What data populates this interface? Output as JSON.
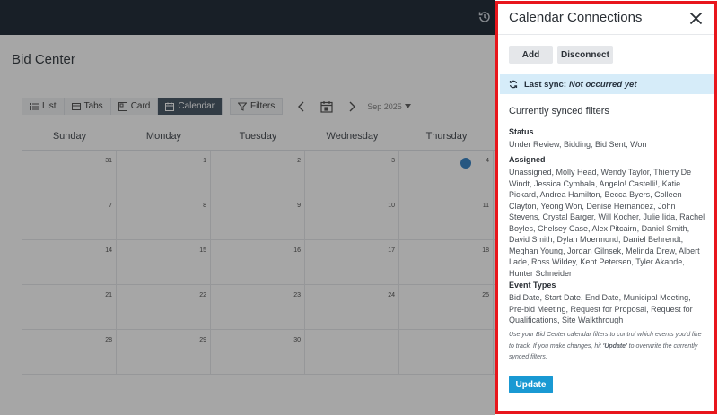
{
  "app": {
    "page_title": "Bid Center",
    "view_buttons": [
      "List",
      "Tabs",
      "Card",
      "Calendar"
    ],
    "active_view": "Calendar",
    "filters_label": "Filters",
    "month": "Sep 2025",
    "weekdays": [
      "Sunday",
      "Monday",
      "Tuesday",
      "Wednesday",
      "Thursday"
    ],
    "weeks": [
      [
        "31",
        "1",
        "2",
        "3",
        "4"
      ],
      [
        "7",
        "8",
        "9",
        "10",
        "11"
      ],
      [
        "14",
        "15",
        "16",
        "17",
        "18"
      ],
      [
        "21",
        "22",
        "23",
        "24",
        "25"
      ],
      [
        "28",
        "29",
        "30",
        "",
        ""
      ]
    ]
  },
  "panel": {
    "title": "Calendar Connections",
    "add_label": "Add",
    "disconnect_label": "Disconnect",
    "sync_label": "Last sync:",
    "sync_value": "Not occurred yet",
    "heading": "Currently synced filters",
    "status_label": "Status",
    "status_values": "Under Review, Bidding, Bid Sent, Won",
    "assigned_label": "Assigned",
    "assigned_values": "Unassigned, Molly Head, Wendy Taylor, Thierry De Windt, Jessica Cymbala, Angelo! Castelli!, Katie Pickard, Andrea Hamilton, Becca Byers, Colleen Clayton, Yeong Won, Denise Hernandez, John Stevens, Crystal Barger, Will Kocher, Julie Iida, Rachel Boyles, Chelsey Case, Alex Pitcairn, Daniel Smith, David Smith, Dylan Moermond, Daniel Behrendt, Meghan Young, Jordan Gilnsek, Melinda Drew, Albert Lade, Ross Wildey, Kent Petersen, Tyler Akande, Hunter Schneider",
    "event_types_label": "Event Types",
    "event_types_values": "Bid Date, Start Date, End Date, Municipal Meeting, Pre-bid Meeting, Request for Proposal, Request for Qualifications, Site Walkthrough",
    "help_before": "Use your Bid Center calendar filters to control which events you'd like to track. If you make changes, hit ",
    "help_emphasis": "'Update'",
    "help_after": " to overwrite the currently synced filters.",
    "update_label": "Update"
  },
  "colors": {
    "highlight_frame": "#e8161c",
    "update_button": "#1999d3",
    "sync_bar": "#d6ecf9"
  }
}
